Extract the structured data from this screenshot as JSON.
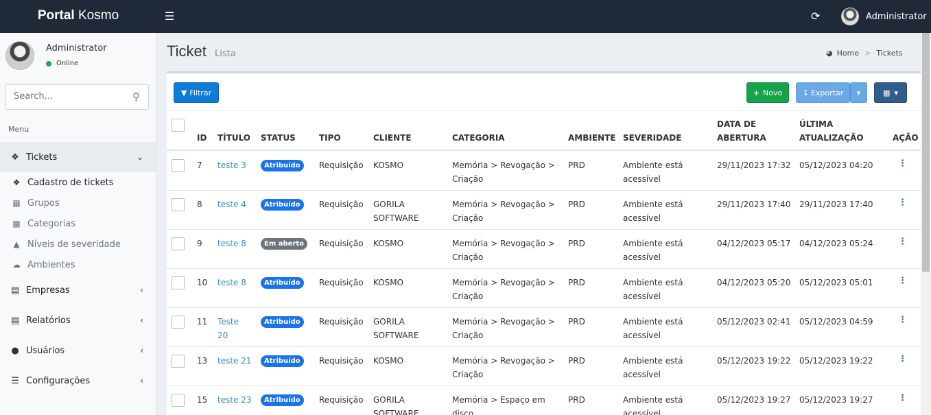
{
  "app": {
    "brand_bold": "Portal",
    "brand_rest": " Kosmo"
  },
  "topbar": {
    "user": "Administrator"
  },
  "sidebar": {
    "user_name": "Administrator",
    "status": "Online",
    "search_placeholder": "Search...",
    "menu_header": "Menu",
    "groups": [
      {
        "label": "Tickets",
        "icon": "ticket-icon",
        "expanded": true
      },
      {
        "label": "Empresas",
        "icon": "building-icon"
      },
      {
        "label": "Relatórios",
        "icon": "report-icon"
      },
      {
        "label": "Usuários",
        "icon": "users-icon"
      },
      {
        "label": "Configurações",
        "icon": "settings-icon"
      }
    ],
    "ticket_items": [
      {
        "label": "Cadastro de tickets",
        "icon": "ticket-icon"
      },
      {
        "label": "Grupos",
        "icon": "cube-icon"
      },
      {
        "label": "Categorias",
        "icon": "cubes-icon"
      },
      {
        "label": "Níveis de severidade",
        "icon": "warning-icon"
      },
      {
        "label": "Ambientes",
        "icon": "cloud-icon"
      }
    ]
  },
  "page": {
    "title": "Ticket",
    "subtitle": "Lista",
    "breadcrumb_home": "Home",
    "breadcrumb_current": "Tickets"
  },
  "toolbar": {
    "filter": "Filtrar",
    "new": "Novo",
    "export": "Exportar"
  },
  "table": {
    "headers": {
      "id": "ID",
      "title": "TÍTULO",
      "status": "STATUS",
      "tipo": "TIPO",
      "cliente": "CLIENTE",
      "categoria": "CATEGORIA",
      "ambiente": "AMBIENTE",
      "severidade": "SEVERIDADE",
      "abertura1": "DATA DE",
      "abertura2": "ABERTURA",
      "atualizacao1": "ÚLTIMA",
      "atualizacao2": "ATUALIZAÇÃO",
      "acao": "AÇÃO"
    },
    "rows": [
      {
        "id": "7",
        "title1": "teste 3",
        "title2": "",
        "status": "Atribuído",
        "tipo": "Requisição",
        "cliente1": "KOSMO",
        "cliente2": "",
        "cat1": "Memória > Revogação >",
        "cat2": "Criação",
        "ambiente": "PRD",
        "sev1": "Ambiente está",
        "sev2": "acessível",
        "abertura": "29/11/2023 17:32",
        "atualizacao": "05/12/2023 04:20"
      },
      {
        "id": "8",
        "title1": "teste 4",
        "title2": "",
        "status": "Atribuído",
        "tipo": "Requisição",
        "cliente1": "GORILA",
        "cliente2": "SOFTWARE",
        "cat1": "Memória > Revogação >",
        "cat2": "Criação",
        "ambiente": "PRD",
        "sev1": "Ambiente está",
        "sev2": "acessível",
        "abertura": "29/11/2023 17:40",
        "atualizacao": "29/11/2023 17:40"
      },
      {
        "id": "9",
        "title1": "teste 8",
        "title2": "",
        "status": "Em aberto",
        "tipo": "Requisição",
        "cliente1": "KOSMO",
        "cliente2": "",
        "cat1": "Memória > Revogação >",
        "cat2": "Criação",
        "ambiente": "PRD",
        "sev1": "Ambiente está",
        "sev2": "acessível",
        "abertura": "04/12/2023 05:17",
        "atualizacao": "04/12/2023 05:24"
      },
      {
        "id": "10",
        "title1": "teste 8",
        "title2": "",
        "status": "Atribuído",
        "tipo": "Requisição",
        "cliente1": "KOSMO",
        "cliente2": "",
        "cat1": "Memória > Revogação >",
        "cat2": "Criação",
        "ambiente": "PRD",
        "sev1": "Ambiente está",
        "sev2": "acessível",
        "abertura": "04/12/2023 05:20",
        "atualizacao": "05/12/2023 05:01"
      },
      {
        "id": "11",
        "title1": "Teste",
        "title2": "20",
        "status": "Atribuído",
        "tipo": "Requisição",
        "cliente1": "GORILA",
        "cliente2": "SOFTWARE",
        "cat1": "Memória > Revogação >",
        "cat2": "Criação",
        "ambiente": "PRD",
        "sev1": "Ambiente está",
        "sev2": "acessível",
        "abertura": "05/12/2023 02:41",
        "atualizacao": "05/12/2023 04:59"
      },
      {
        "id": "13",
        "title1": "teste 21",
        "title2": "",
        "status": "Atribuído",
        "tipo": "Requisição",
        "cliente1": "KOSMO",
        "cliente2": "",
        "cat1": "Memória > Revogação >",
        "cat2": "Criação",
        "ambiente": "PRD",
        "sev1": "Ambiente está",
        "sev2": "acessível",
        "abertura": "05/12/2023 19:22",
        "atualizacao": "05/12/2023 19:22"
      },
      {
        "id": "15",
        "title1": "teste 23",
        "title2": "",
        "status": "Atribuído",
        "tipo": "Requisição",
        "cliente1": "GORILA",
        "cliente2": "SOFTWARE",
        "cat1": "Memória > Espaço em",
        "cat2": "disco",
        "ambiente": "PRD",
        "sev1": "Ambiente está",
        "sev2": "acessível",
        "abertura": "05/12/2023 19:27",
        "atualizacao": "05/12/2023 19:27"
      }
    ]
  },
  "colors": {
    "topbar": "#1f2937",
    "primary": "#0d7bd8",
    "success": "#16a34a",
    "badge_assigned": "#1a73e8",
    "badge_open": "#6c757d"
  }
}
